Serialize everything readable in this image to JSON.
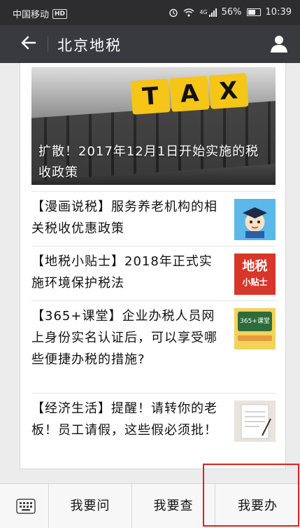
{
  "status_bar": {
    "carrier": "中国移动",
    "hd": "HD",
    "network": "4G",
    "battery": "56%",
    "time": "10:39"
  },
  "nav": {
    "title": "北京地税",
    "back_icon": "back-arrow-icon",
    "user_icon": "person-icon"
  },
  "hero": {
    "tax_letters": [
      "T",
      "A",
      "X"
    ],
    "caption": "扩散！2017年12月1日开始实施的税收政策"
  },
  "articles": [
    {
      "title": "【漫画说税】服务养老机构的相关税收优惠政策",
      "thumb": "cartoon-graduate-icon"
    },
    {
      "title": "【地税小贴士】2018年正式实施环境保护税法",
      "thumb_line1": "地税",
      "thumb_line2": "小贴士",
      "thumb_color": "#d9362b"
    },
    {
      "title": "【365+课堂】企业办税人员网上身份实名认证后，可以享受哪些便捷办税的措施?",
      "thumb_text": "365+课堂",
      "thumb_color": "#2e6b3a"
    },
    {
      "title": "【经济生活】提醒！请转你的老板！员工请假，这些假必须批！",
      "thumb": "leave-form-icon"
    }
  ],
  "tabbar": {
    "keyboard_icon": "keyboard-icon",
    "tabs": [
      "我要问",
      "我要查",
      "我要办"
    ]
  },
  "highlight_color": "#e02020"
}
